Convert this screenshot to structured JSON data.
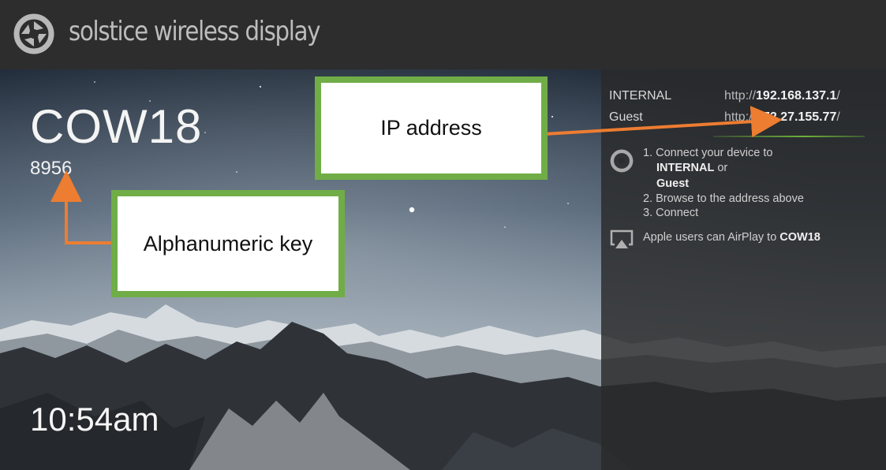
{
  "header": {
    "title": "solstice wireless display",
    "logo_icon": "solstice-aperture-icon"
  },
  "room": {
    "name": "COW18",
    "key": "8956",
    "time": "10:54am"
  },
  "networks": [
    {
      "label": "INTERNAL",
      "url_prefix": "http://",
      "address": "192.168.137.1",
      "url_suffix": "/"
    },
    {
      "label": "Guest",
      "url_prefix": "http://",
      "address": "172.27.155.77",
      "url_suffix": "/"
    }
  ],
  "instructions": {
    "step1": "1. Connect your device to",
    "network1": "INTERNAL",
    "or": "or",
    "network2": "Guest",
    "step2": "2. Browse to the address above",
    "step3": "3. Connect",
    "airplay_prefix": "Apple users can AirPlay to",
    "airplay_name": "COW18",
    "steps_icon": "solstice-aperture-icon",
    "airplay_icon": "airplay-icon"
  },
  "callouts": {
    "ip": "IP address",
    "key": "Alphanumeric key"
  },
  "colors": {
    "callout_border": "#70ad47",
    "arrow": "#ed7d31",
    "divider": "#6db13a"
  }
}
